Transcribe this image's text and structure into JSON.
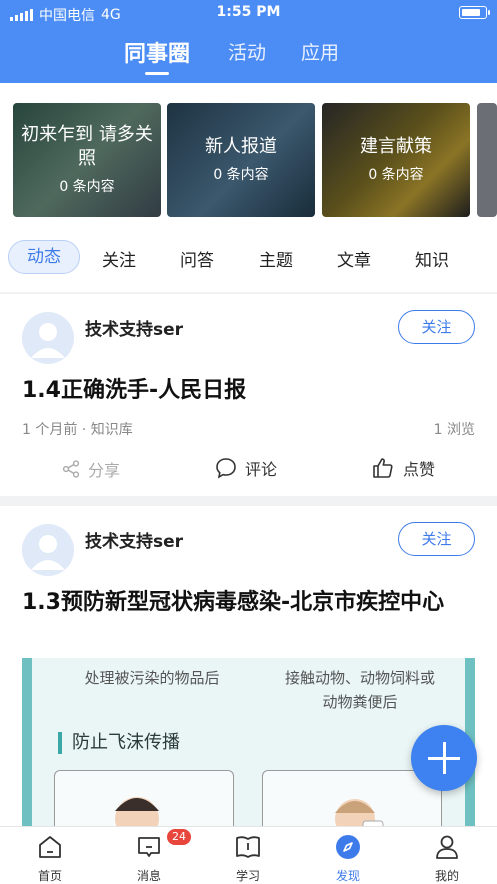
{
  "status_bar": {
    "carrier": "中国电信",
    "network": "4G",
    "time": "1:55 PM"
  },
  "top_tabs": [
    {
      "label": "同事圈",
      "active": true
    },
    {
      "label": "活动",
      "active": false
    },
    {
      "label": "应用",
      "active": false
    }
  ],
  "cards": [
    {
      "title": "初来乍到 请多关照",
      "count": "0 条内容"
    },
    {
      "title": "新人报道",
      "count": "0 条内容"
    },
    {
      "title": "建言献策",
      "count": "0 条内容"
    }
  ],
  "sub_tabs": [
    "动态",
    "关注",
    "问答",
    "主题",
    "文章",
    "知识"
  ],
  "posts": [
    {
      "author": "技术支持ser",
      "follow_label": "关注",
      "title": "1.4正确洗手-人民日报",
      "meta": "1 个月前 · 知识库",
      "views": "1 浏览",
      "share_label": "分享",
      "comment_label": "评论",
      "like_label": "点赞"
    },
    {
      "author": "技术支持ser",
      "follow_label": "关注",
      "title": "1.3预防新型冠状病毒感染-北京市疾控中心"
    }
  ],
  "figure": {
    "text_left": "处理被污染的物品后",
    "text_right": "接触动物、动物饲料或动物粪便后",
    "heading": "防止飞沫传播"
  },
  "bottom_nav": [
    {
      "label": "首页",
      "active": false
    },
    {
      "label": "消息",
      "active": false,
      "badge": "24"
    },
    {
      "label": "学习",
      "active": false
    },
    {
      "label": "发现",
      "active": true
    },
    {
      "label": "我的",
      "active": false
    }
  ],
  "colors": {
    "brand": "#4c8cf5",
    "accent": "#3e7bea",
    "badge": "#e8453c"
  }
}
